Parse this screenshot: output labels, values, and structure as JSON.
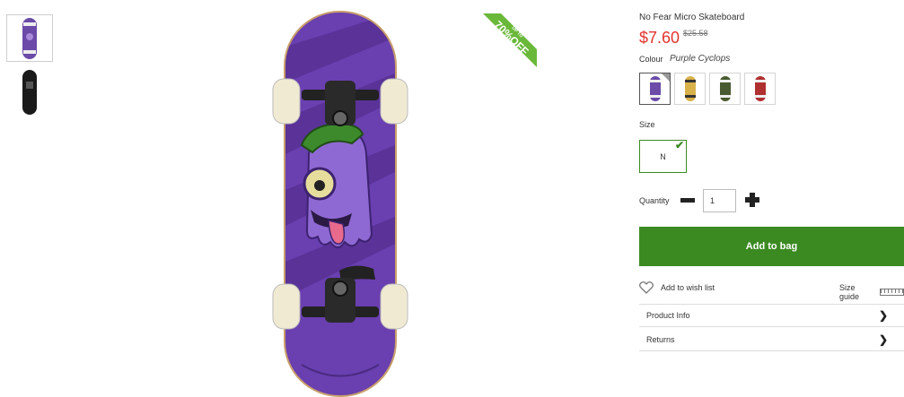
{
  "gallery": {
    "thumbnails": [
      "skateboard-front-thumbnail",
      "skateboard-bottom-thumbnail"
    ]
  },
  "badge": {
    "line1": "UP TO",
    "line2": "70%OFF",
    "color": "#6ab839"
  },
  "product": {
    "title": "No Fear Micro Skateboard",
    "price": "$7.60",
    "old_price": "$25.58",
    "colour_label": "Colour",
    "colour_value": "Purple Cyclops",
    "colour_swatches": [
      {
        "name": "Purple Cyclops",
        "color": "#6b4aa8",
        "selected": true
      },
      {
        "name": "Yellow",
        "color": "#d8b14a",
        "selected": false
      },
      {
        "name": "Green",
        "color": "#5e7a3a",
        "selected": false
      },
      {
        "name": "Red",
        "color": "#b03030",
        "selected": false
      }
    ],
    "size_label": "Size",
    "size_value": "N",
    "quantity_label": "Quantity",
    "quantity_value": "1",
    "add_to_bag_label": "Add to bag",
    "wish_list_label": "Add to wish list",
    "size_guide_label": "Size guide",
    "accordion": [
      {
        "label": "Product Info"
      },
      {
        "label": "Returns"
      }
    ]
  },
  "colors": {
    "price": "#e3342f",
    "accent_green": "#3b8a21"
  },
  "icons": {
    "heart": "heart-icon",
    "chevron": "chevron-right-icon",
    "minus": "minus-icon",
    "plus": "plus-icon",
    "check": "check-icon"
  }
}
